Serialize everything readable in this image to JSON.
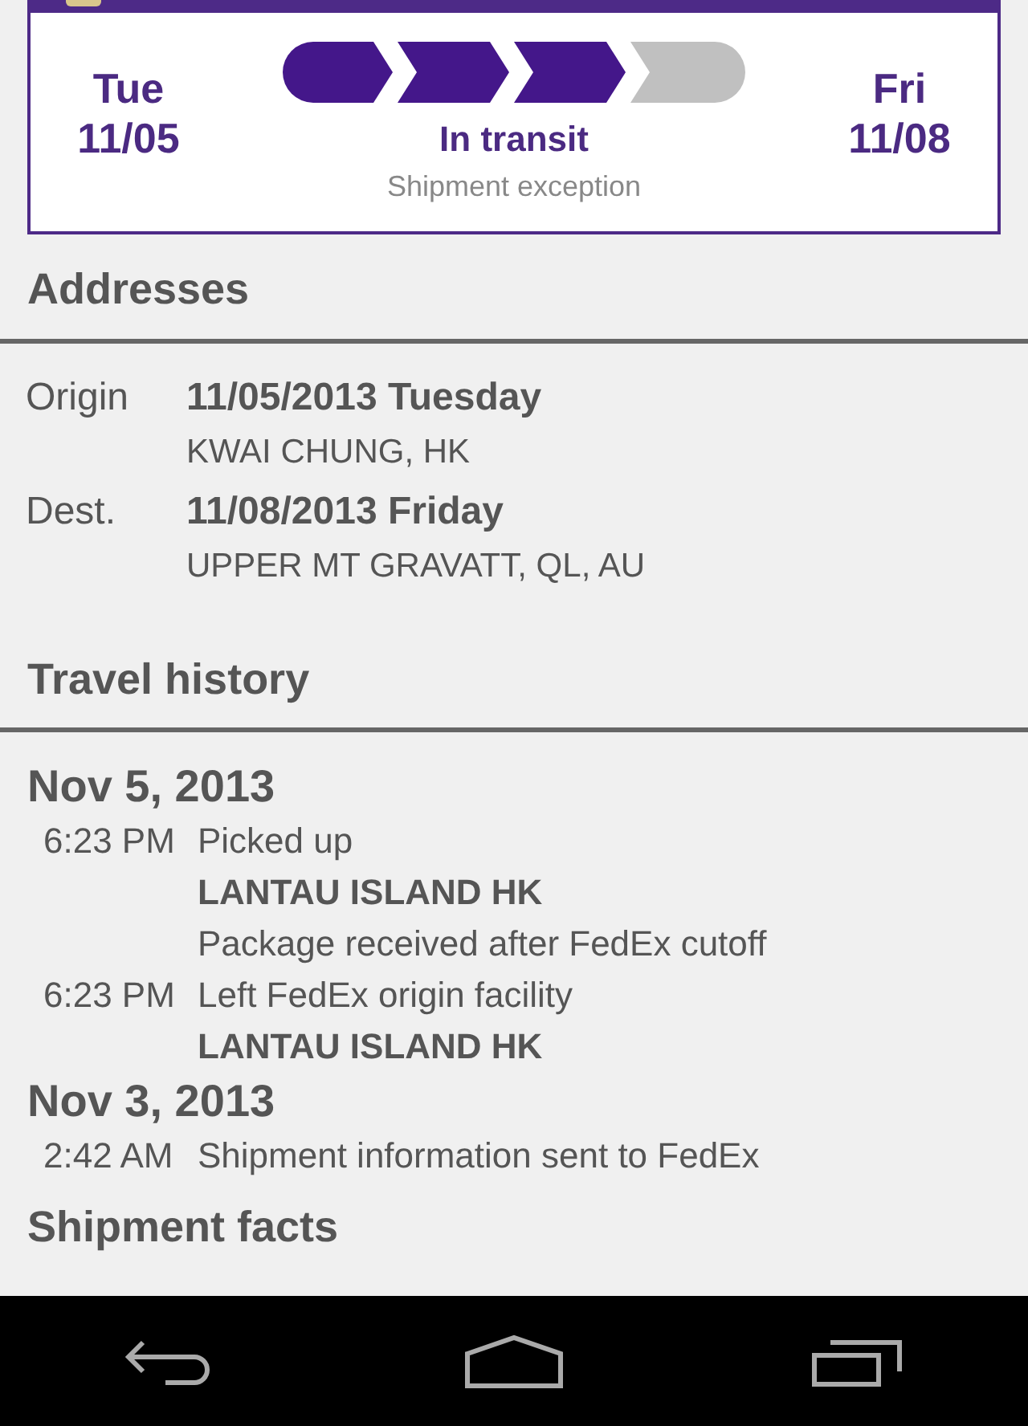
{
  "status_card": {
    "start": {
      "day": "Tue",
      "date": "11/05"
    },
    "end": {
      "day": "Fri",
      "date": "11/08"
    },
    "progress_steps": [
      {
        "done": true
      },
      {
        "done": true
      },
      {
        "done": true
      },
      {
        "done": false
      }
    ],
    "status": "In transit",
    "substatus": "Shipment exception"
  },
  "addresses": {
    "title": "Addresses",
    "rows": [
      {
        "label": "Origin",
        "date": "11/05/2013 Tuesday",
        "place": "KWAI CHUNG, HK"
      },
      {
        "label": "Dest.",
        "date": "11/08/2013 Friday",
        "place": "UPPER MT GRAVATT, QL, AU"
      }
    ]
  },
  "travel_history": {
    "title": "Travel history",
    "days": [
      {
        "date": "Nov 5, 2013",
        "events": [
          {
            "time": "6:23 PM",
            "lines": [
              {
                "text": "Picked up",
                "bold": false
              },
              {
                "text": "LANTAU ISLAND HK",
                "bold": true
              },
              {
                "text": "Package received after FedEx cutoff",
                "bold": false
              }
            ]
          },
          {
            "time": "6:23 PM",
            "lines": [
              {
                "text": "Left FedEx origin facility",
                "bold": false
              },
              {
                "text": "LANTAU ISLAND HK",
                "bold": true
              }
            ]
          }
        ]
      },
      {
        "date": "Nov 3, 2013",
        "events": [
          {
            "time": "2:42 AM",
            "lines": [
              {
                "text": "Shipment information sent to FedEx",
                "bold": false
              }
            ]
          }
        ]
      }
    ]
  },
  "next_section": {
    "title": "Shipment facts"
  }
}
